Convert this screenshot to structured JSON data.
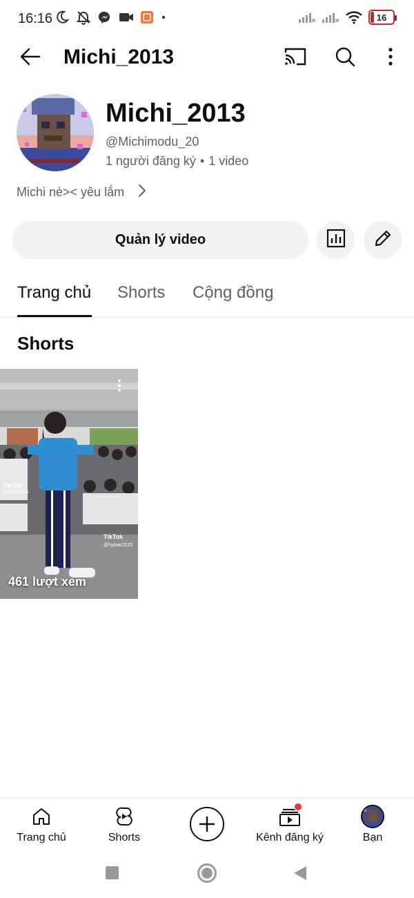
{
  "status_bar": {
    "time": "16:16",
    "battery_level": "16",
    "icons_left": [
      "moon-icon",
      "bell-off-icon",
      "messenger-icon",
      "video-camera-icon",
      "app-notification-icon",
      "dot-icon"
    ],
    "icons_right": [
      "signal-x-icon",
      "signal-x-icon",
      "wifi-icon",
      "battery-icon"
    ]
  },
  "app_bar": {
    "title": "Michi_2013",
    "icons": [
      "back-arrow-icon",
      "cast-icon",
      "search-icon",
      "more-vertical-icon"
    ]
  },
  "channel": {
    "name": "Michi_2013",
    "handle": "@Michimodu_20",
    "subscribers": "1 người đăng ký",
    "separator": "•",
    "videos": "1 video",
    "description": "Michi nè>< yêu lắm"
  },
  "actions": {
    "manage_videos_label": "Quản lý video",
    "analytics_icon": "analytics-icon",
    "edit_icon": "pencil-icon"
  },
  "tabs": [
    {
      "label": "Trang chủ",
      "active": true
    },
    {
      "label": "Shorts",
      "active": false
    },
    {
      "label": "Cộng đồng",
      "active": false
    }
  ],
  "section": {
    "title": "Shorts"
  },
  "shorts": [
    {
      "views": "461 lượt xem",
      "overlay_text_1": "TikTok",
      "overlay_text_2": "@skishack1",
      "overlay_text_3": "TikTok",
      "overlay_text_4": "@hytran2015"
    }
  ],
  "bottom_nav": [
    {
      "label": "Trang chủ",
      "icon": "home-icon"
    },
    {
      "label": "Shorts",
      "icon": "shorts-icon"
    },
    {
      "label": "",
      "icon": "create-plus-icon"
    },
    {
      "label": "Kênh đăng ký",
      "icon": "subscriptions-icon",
      "notification_dot": true
    },
    {
      "label": "Bạn",
      "icon": "profile-avatar"
    }
  ],
  "colors": {
    "text_primary": "#0f0f0f",
    "text_secondary": "#606060",
    "button_bg": "#f2f2f2",
    "notification_red": "#e53935",
    "battery_red": "#c62828"
  }
}
